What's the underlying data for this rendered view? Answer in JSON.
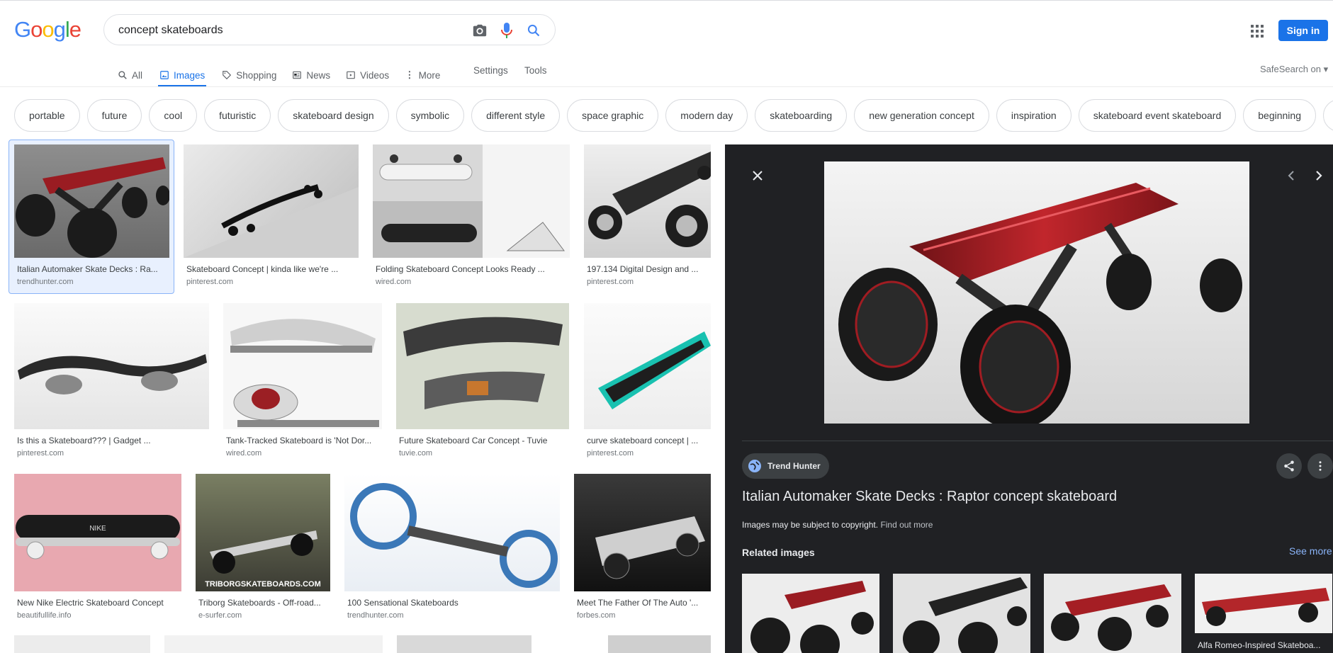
{
  "brand": {
    "logo": "Google"
  },
  "search": {
    "query": "concept skateboards"
  },
  "header": {
    "signin": "Sign in"
  },
  "tabs": [
    {
      "label": "All"
    },
    {
      "label": "Images"
    },
    {
      "label": "Shopping"
    },
    {
      "label": "News"
    },
    {
      "label": "Videos"
    },
    {
      "label": "More"
    }
  ],
  "settings_label": "Settings",
  "tools_label": "Tools",
  "safesearch": "SafeSearch on",
  "chips": [
    "portable",
    "future",
    "cool",
    "futuristic",
    "skateboard design",
    "symbolic",
    "different style",
    "space graphic",
    "modern day",
    "skateboarding",
    "new generation concept",
    "inspiration",
    "skateboard event skateboard",
    "beginning",
    "p"
  ],
  "results": [
    {
      "title": "Italian Automaker Skate Decks : Ra...",
      "source": "trendhunter.com"
    },
    {
      "title": "Skateboard Concept | kinda like we're ...",
      "source": "pinterest.com"
    },
    {
      "title": "Folding Skateboard Concept Looks Ready ...",
      "source": "wired.com"
    },
    {
      "title": "197.134 Digital Design and ...",
      "source": "pinterest.com"
    },
    {
      "title": "Is this a Skateboard??? | Gadget ...",
      "source": "pinterest.com"
    },
    {
      "title": "Tank-Tracked Skateboard is 'Not Dor...",
      "source": "wired.com"
    },
    {
      "title": "Future Skateboard Car Concept - Tuvie",
      "source": "tuvie.com"
    },
    {
      "title": "curve skateboard concept | ...",
      "source": "pinterest.com"
    },
    {
      "title": "New Nike Electric Skateboard Concept",
      "source": "beautifullife.info"
    },
    {
      "title": "Triborg Skateboards - Off-road...",
      "source": "e-surfer.com"
    },
    {
      "title": "100 Sensational Skateboards",
      "source": "trendhunter.com"
    },
    {
      "title": "Meet The Father Of The Auto '...",
      "source": "forbes.com"
    }
  ],
  "thumb_texts": {
    "nike": "NIKE",
    "triborg": "TRIBORGSKATEBOARDS.COM"
  },
  "panel": {
    "source_name": "Trend Hunter",
    "title": "Italian Automaker Skate Decks : Raptor concept skateboard",
    "copyright": "Images may be subject to copyright.",
    "find_out_more": "Find out more",
    "related_heading": "Related images",
    "see_more": "See more",
    "related": [
      {
        "caption": ""
      },
      {
        "caption": ""
      },
      {
        "caption": ""
      },
      {
        "caption": "Alfa Romeo-Inspired Skateboa..."
      }
    ]
  },
  "colors": {
    "accent": "#1a73e8",
    "panel_bg": "#202124",
    "deck_red": "#b3262a"
  }
}
